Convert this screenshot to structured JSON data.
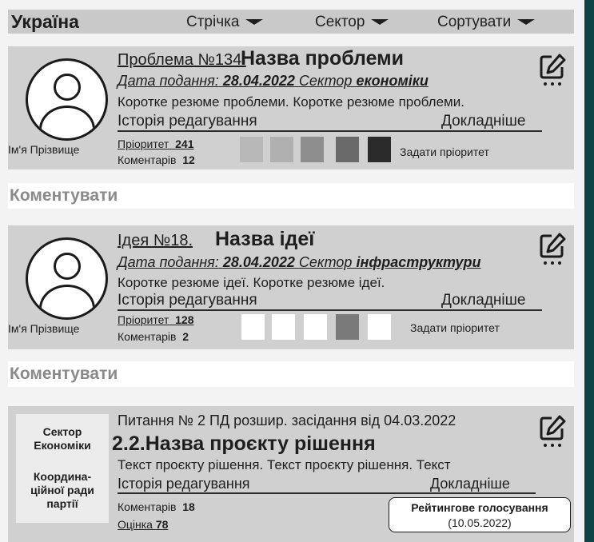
{
  "header": {
    "title": "Україна",
    "filters": [
      "Стрічка",
      "Сектор",
      "Сортувати"
    ]
  },
  "problem_card": {
    "number_label": "Проблема №134.",
    "title": "Назва проблеми",
    "date_label": "Дата подання:",
    "date": "28.04.2022",
    "sector_label": "Сектор",
    "sector": "економіки",
    "summary": "Коротке резюме проблеми. Коротке резюме проблеми.",
    "history_link": "Історія редагування",
    "details_link": "Докладніше",
    "author": "Ім'я Прізвище",
    "priority_label": "Пріоритет",
    "priority_value": "241",
    "comments_label": "Коментарів",
    "comments_value": "12",
    "set_priority_label": "Задати пріоритет",
    "priority_colors": [
      "#b8b8b8",
      "#b0b0b0",
      "#8e8e8e",
      "#6a6a6a",
      "#2b2b2b"
    ]
  },
  "comment_bar_1": "Коментувати",
  "idea_card": {
    "number_label": "Ідея №18.",
    "title": "Назва ідеї",
    "date_label": "Дата подання:",
    "date": "28.04.2022",
    "sector_label": "Сектор",
    "sector": "інфраструктури",
    "summary": "Коротке резюме ідеї. Коротке резюме ідеї.",
    "history_link": "Історія редагування",
    "details_link": "Докладніше",
    "author": "Ім'я Прізвище",
    "priority_label": "Пріоритет",
    "priority_value": "128",
    "comments_label": "Коментарів",
    "comments_value": "2",
    "set_priority_label": "Задати пріоритет",
    "priority_colors": [
      "#ffffff",
      "#ffffff",
      "#ffffff",
      "#7a7a7a",
      "#ffffff"
    ]
  },
  "comment_bar_2": "Коментувати",
  "decision_card": {
    "sector_line1": "Сектор",
    "sector_line2": "Економіки",
    "council_line1": "Координа-",
    "council_line2": "ційної ради",
    "council_line3": "партії",
    "meeting": "Питання № 2 ПД розшир. засідання від 04.03.2022",
    "title": "2.2.Назва проєкту рішення",
    "text": "Текст проєкту рішення. Текст проєкту рішення.  Текст",
    "history_link": "Історія редагування",
    "details_link": "Докладніше",
    "comments_label": "Коментарів",
    "comments_value": "18",
    "rating_label": "Оцінка",
    "rating_value": "78",
    "vote_button": "Рейтингове голосування",
    "vote_date": "(10.05.2022)"
  }
}
